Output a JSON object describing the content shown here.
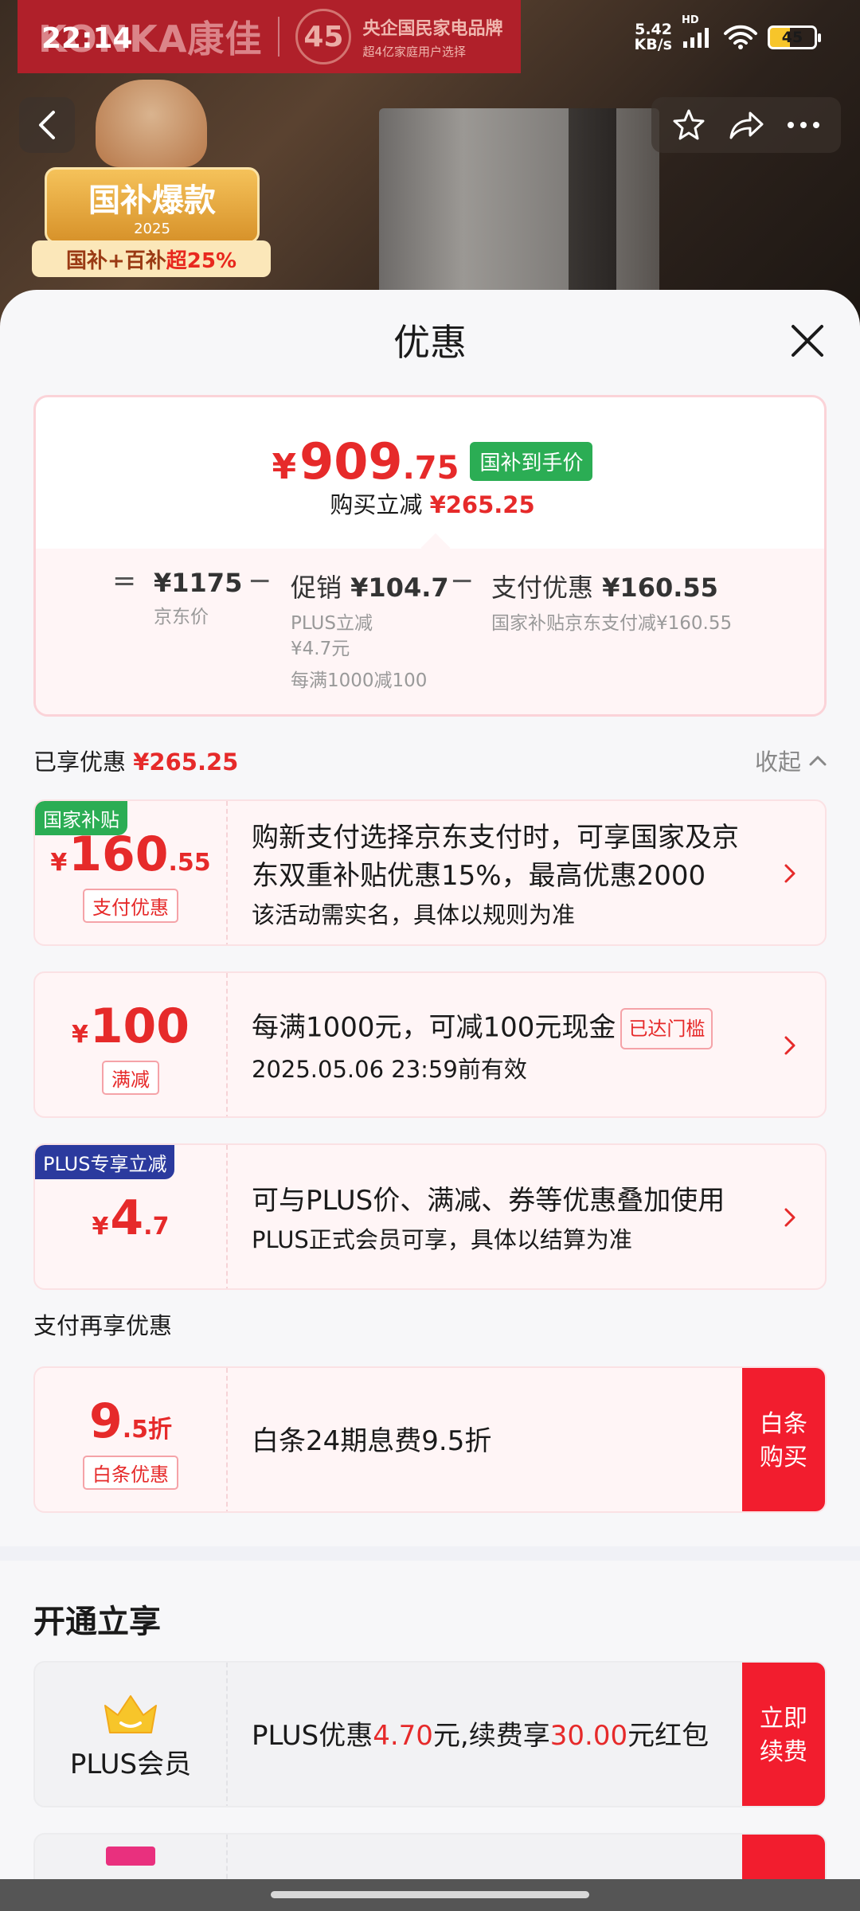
{
  "status_bar": {
    "time": "22:14",
    "net_speed_value": "5.42",
    "net_speed_unit": "KB/s",
    "hd": "HD",
    "battery": "45"
  },
  "hero": {
    "brand_logo": "KONKA康佳",
    "brand_badge": "45",
    "brand_line1": "央企国民家电品牌",
    "brand_line2": "超4亿家庭用户选择",
    "sticker_title": "国补爆款",
    "sticker_year": "2025",
    "sticker_ribbon_prefix": "国补+百补",
    "sticker_ribbon_highlight": "超25%"
  },
  "sheet": {
    "title": "优惠",
    "price": {
      "currency": "¥",
      "integer": "909",
      "decimal": ".75",
      "tag": "国补到手价",
      "sub_label": "购买立减",
      "sub_amount": "¥265.25"
    },
    "breakdown": {
      "eq": "=",
      "minus": "−",
      "base_value": "¥1175",
      "base_label": "京东价",
      "promo_label": "促销",
      "promo_value": "¥104.7",
      "promo_sub1": "PLUS立减",
      "promo_sub2": "¥4.7元",
      "promo_sub3": "每满1000减100",
      "pay_label": "支付优惠",
      "pay_value": "¥160.55",
      "pay_sub": "国家补贴京东支付减¥160.55"
    },
    "enjoyed_label": "已享优惠",
    "enjoyed_amount": "¥265.25",
    "collapse_label": "收起",
    "coupons": [
      {
        "corner": "国家补贴",
        "currency": "¥",
        "integer": "160",
        "decimal": ".55",
        "kind": "支付优惠",
        "title": "购新支付选择京东支付时，可享国家及京东双重补贴优惠15%，最高优惠2000",
        "subtitle": "该活动需实名，具体以规则为准"
      },
      {
        "currency": "¥",
        "integer": "100",
        "kind": "满减",
        "title": "每满1000元，可减100元现金",
        "reached": "已达门槛",
        "subtitle": "2025.05.06 23:59前有效"
      },
      {
        "corner": "PLUS专享立减",
        "currency": "¥",
        "integer": "4",
        "decimal": ".7",
        "title": "可与PLUS价、满减、券等优惠叠加使用",
        "subtitle": "PLUS正式会员可享，具体以结算为准"
      }
    ],
    "pay_section_label": "支付再享优惠",
    "baitiao": {
      "integer": "9",
      "decimal": ".5折",
      "kind": "白条优惠",
      "title": "白条24期息费9.5折",
      "cta": "白条购买"
    },
    "open_title": "开通立享",
    "plus_card": {
      "label": "PLUS会员",
      "text_a": "PLUS优惠",
      "amount_a": "4.70",
      "text_b": "元,续费享",
      "amount_b": "30.00",
      "text_c": "元红包",
      "cta": "立即续费"
    }
  },
  "colors": {
    "accent_red": "#e62a2a",
    "cta_red": "#f21d2e",
    "subsidy_green": "#2bad54",
    "plus_blue": "#2b3a9e"
  }
}
